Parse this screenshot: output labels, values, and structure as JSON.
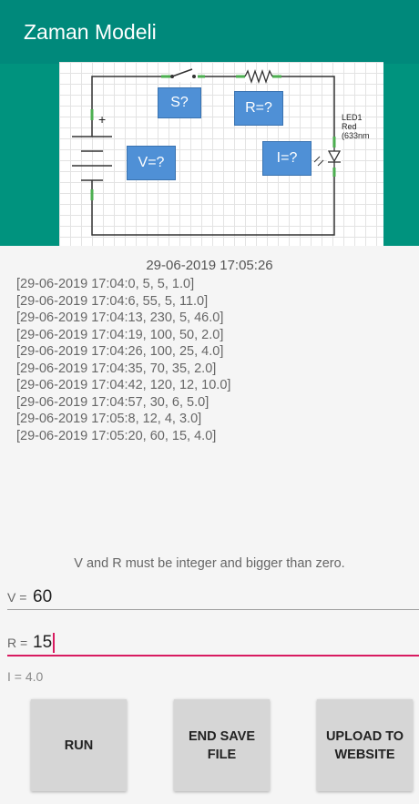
{
  "app": {
    "title": "Zaman Modeli"
  },
  "circuit": {
    "switch_label": "S?",
    "resistor_label": "R=?",
    "voltage_label": "V=?",
    "current_label": "I=?",
    "battery_sign": "+",
    "led_name": "LED1",
    "led_color": "Red (633nm"
  },
  "log": {
    "timestamp": "29-06-2019 17:05:26",
    "entries": [
      "[29-06-2019 17:04:0, 5, 5, 1.0]",
      "[29-06-2019 17:04:6, 55, 5, 11.0]",
      "[29-06-2019 17:04:13, 230, 5, 46.0]",
      "[29-06-2019 17:04:19, 100, 50, 2.0]",
      "[29-06-2019 17:04:26, 100, 25, 4.0]",
      "[29-06-2019 17:04:35, 70, 35, 2.0]",
      "[29-06-2019 17:04:42, 120, 12, 10.0]",
      "[29-06-2019 17:04:57, 30, 6, 5.0]",
      "[29-06-2019 17:05:8, 12, 4, 3.0]",
      "[29-06-2019 17:05:20, 60, 15, 4.0]"
    ]
  },
  "form": {
    "hint": "V and R must be integer and bigger than zero.",
    "v_label": "V =",
    "v_value": "60",
    "r_label": "R =",
    "r_value": "15",
    "result": "I = 4.0"
  },
  "buttons": {
    "run": "RUN",
    "end_save": "END SAVE\nFILE",
    "upload": "UPLOAD TO\nWEBSITE"
  },
  "colors": {
    "appbar": "#00897b",
    "accent": "#d81b60",
    "box": "#4f90d6"
  }
}
